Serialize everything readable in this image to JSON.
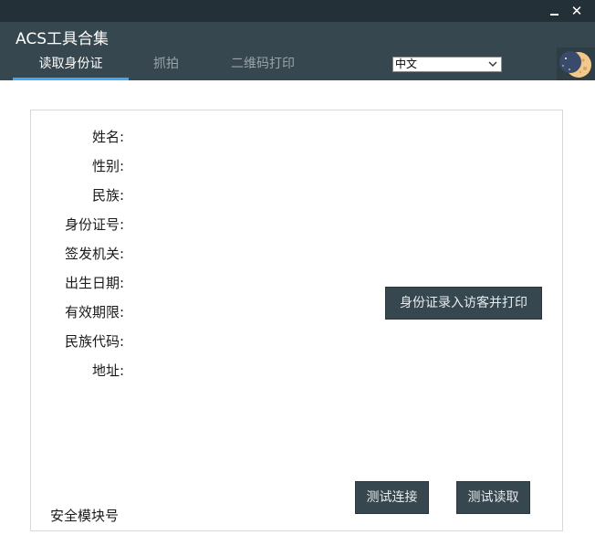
{
  "window": {
    "minimize_glyph": "",
    "close_glyph": "✕"
  },
  "header": {
    "app_title": "ACS工具合集",
    "tabs": [
      {
        "label": "读取身份证",
        "active": true
      },
      {
        "label": "抓拍",
        "active": false
      },
      {
        "label": "二维码打印",
        "active": false
      }
    ],
    "language": {
      "selected": "中文"
    },
    "accent_color": "#3fa9f5",
    "background_color": "#37474f"
  },
  "form": {
    "fields": [
      {
        "label": "姓名:"
      },
      {
        "label": "性别:"
      },
      {
        "label": "民族:"
      },
      {
        "label": "身份证号:"
      },
      {
        "label": "签发机关:"
      },
      {
        "label": "出生日期:"
      },
      {
        "label": "有效期限:"
      },
      {
        "label": "民族代码:"
      },
      {
        "label": "地址:"
      }
    ],
    "register_print_button": "身份证录入访客并打印",
    "test_connect_button": "测试连接",
    "test_read_button": "测试读取",
    "sam_label": "安全模块号"
  }
}
